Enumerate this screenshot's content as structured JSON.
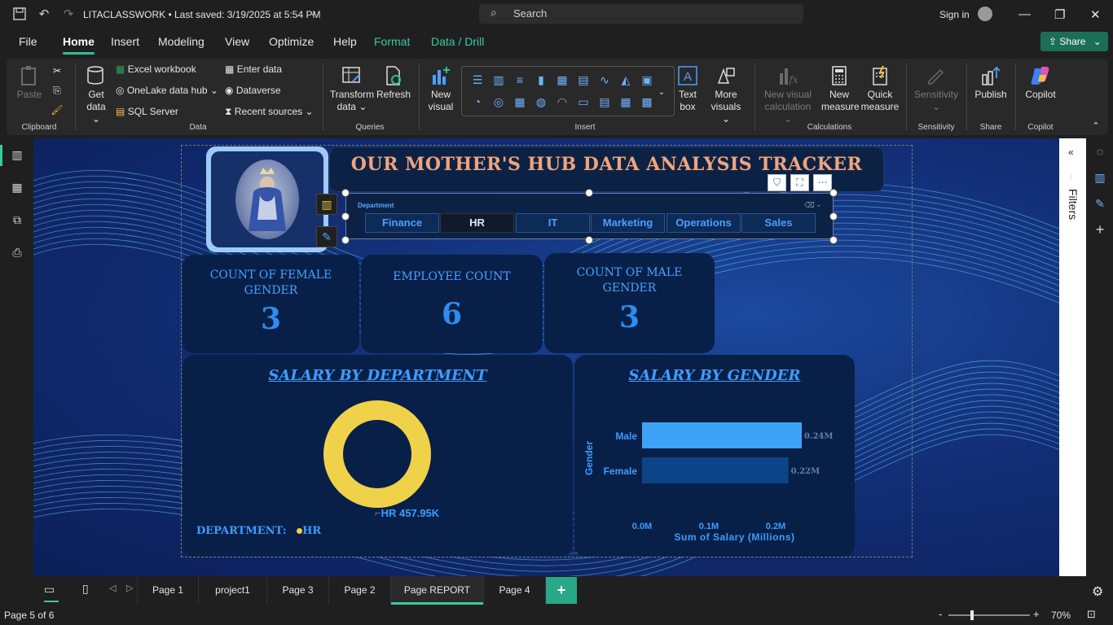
{
  "titlebar": {
    "doc_title": "LITACLASSWORK • Last saved: 3/19/2025 at 5:54 PM",
    "search_placeholder": "Search",
    "signin": "Sign in"
  },
  "menu": {
    "file": "File",
    "home": "Home",
    "insert": "Insert",
    "modeling": "Modeling",
    "view": "View",
    "optimize": "Optimize",
    "help": "Help",
    "format": "Format",
    "data_drill": "Data / Drill",
    "share": "Share"
  },
  "ribbon": {
    "paste": "Paste",
    "clipboard": "Clipboard",
    "get_data": [
      "Get",
      "data"
    ],
    "excel": "Excel workbook",
    "onelake": "OneLake data hub",
    "sql": "SQL Server",
    "enter_data": "Enter data",
    "dataverse": "Dataverse",
    "recent": "Recent sources",
    "data_group": "Data",
    "transform": [
      "Transform",
      "data"
    ],
    "refresh": "Refresh",
    "queries": "Queries",
    "new_visual": [
      "New",
      "visual"
    ],
    "insert_group": "Insert",
    "text_box": [
      "Text",
      "box"
    ],
    "more_visuals": [
      "More",
      "visuals"
    ],
    "new_visual_calc": [
      "New visual",
      "calculation"
    ],
    "new_measure": [
      "New",
      "measure"
    ],
    "quick_measure": [
      "Quick",
      "measure"
    ],
    "calculations": "Calculations",
    "sensitivity": "Sensitivity",
    "sensitivity_group": "Sensitivity",
    "publish": "Publish",
    "share_group": "Share",
    "copilot": "Copilot",
    "copilot_group": "Copilot"
  },
  "filters_pane": "Filters",
  "report": {
    "title": "OUR MOTHER'S HUB DATA ANALYSIS TRACKER",
    "slicer": {
      "header": "Department",
      "options": [
        "Finance",
        "HR",
        "IT",
        "Marketing",
        "Operations",
        "Sales"
      ],
      "selected": "HR"
    },
    "cards": [
      {
        "label": "COUNT OF FEMALE GENDER",
        "value": "3"
      },
      {
        "label": "EMPLOYEE COUNT",
        "value": "6"
      },
      {
        "label": "COUNT OF MALE GENDER",
        "value": "3"
      }
    ],
    "donut": {
      "title": "SALARY BY DEPARTMENT",
      "data_label": "HR 457.95K",
      "legend_title": "DEPARTMENT:",
      "legend_item": "HR",
      "color": "#f0d24a"
    },
    "bar": {
      "title": "SALARY BY GENDER",
      "ylabel": "Gender",
      "xlabel": "Sum of Salary (Millions)",
      "ticks": [
        "0.0M",
        "0.1M",
        "0.2M"
      ]
    }
  },
  "chart_data": [
    {
      "type": "pie",
      "title": "SALARY BY DEPARTMENT",
      "categories": [
        "HR"
      ],
      "values": [
        457.95
      ],
      "unit": "K"
    },
    {
      "type": "bar",
      "title": "SALARY BY GENDER",
      "orientation": "horizontal",
      "categories": [
        "Male",
        "Female"
      ],
      "values": [
        0.24,
        0.22
      ],
      "labels": [
        "0.24M",
        "0.22M"
      ],
      "xlabel": "Sum of Salary (Millions)",
      "ylabel": "Gender",
      "xlim": [
        0,
        0.24
      ],
      "colors": [
        "#3ea2f5",
        "#0c4488"
      ]
    }
  ],
  "pages": {
    "tabs": [
      "Page 1",
      "project1",
      "Page 3",
      "Page 2",
      "Page REPORT",
      "Page 4"
    ],
    "active": "Page REPORT"
  },
  "status": {
    "page_of": "Page 5 of 6",
    "zoom": "70%",
    "zoom_value": 0.7
  }
}
